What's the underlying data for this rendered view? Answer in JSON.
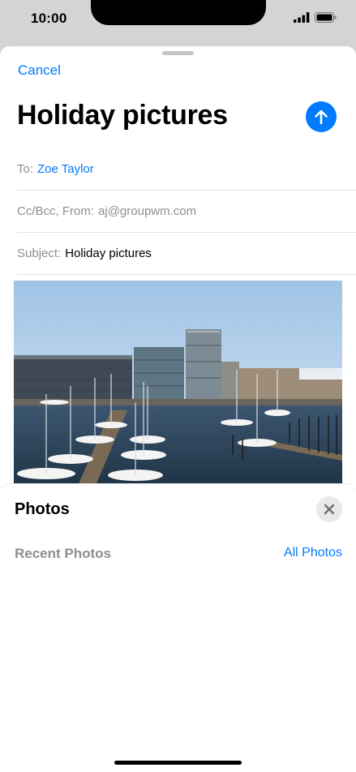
{
  "status_bar": {
    "time": "10:00"
  },
  "header": {
    "cancel_label": "Cancel",
    "title": "Holiday pictures"
  },
  "fields": {
    "to_label": "To:",
    "to_value": "Zoe Taylor",
    "cc_label": "Cc/Bcc, From:",
    "cc_value": "aj@groupwm.com",
    "subject_label": "Subject:",
    "subject_value": "Holiday pictures"
  },
  "photos_panel": {
    "title": "Photos",
    "recent_label": "Recent Photos",
    "all_photos_label": "All Photos"
  },
  "colors": {
    "accent": "#007aff",
    "secondary_text": "#8e8e93"
  },
  "icons": [
    "signal-icon",
    "battery-icon",
    "send-arrow-icon",
    "close-icon"
  ]
}
